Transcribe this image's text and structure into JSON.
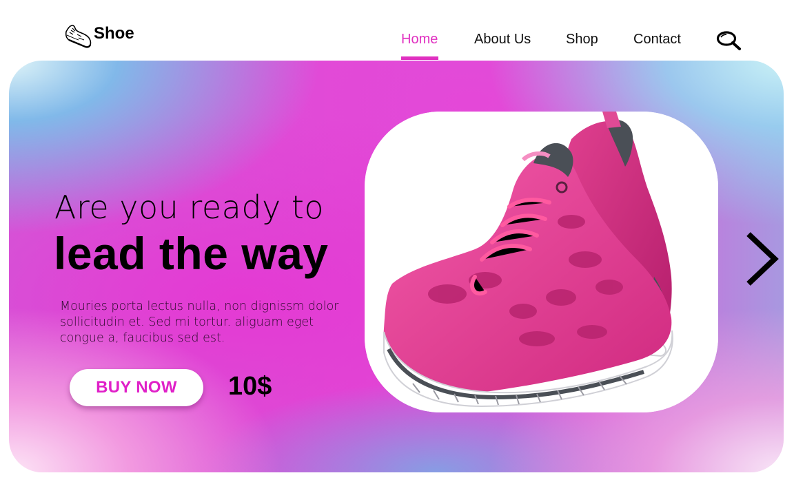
{
  "brand": {
    "name": "Shoe",
    "logo_icon": "sneaker-icon"
  },
  "nav": {
    "items": [
      {
        "label": "Home",
        "active": true
      },
      {
        "label": "About Us",
        "active": false
      },
      {
        "label": "Shop",
        "active": false
      },
      {
        "label": "Contact",
        "active": false
      }
    ],
    "search_icon": "search-icon",
    "active_color": "#e030c0"
  },
  "hero": {
    "line1": "Are you ready to",
    "line2": "lead the way",
    "description": "Mouries porta lectus nulla, non dignissm dolor sollicitudin et. Sed mi tortur. aliguam eget congue a, faucibus sed est.",
    "buy_label": "BUY NOW",
    "price": "10$",
    "product_image": "pink-running-shoes-image",
    "next_icon": "chevron-right-icon",
    "accent_color": "#e020c8"
  }
}
